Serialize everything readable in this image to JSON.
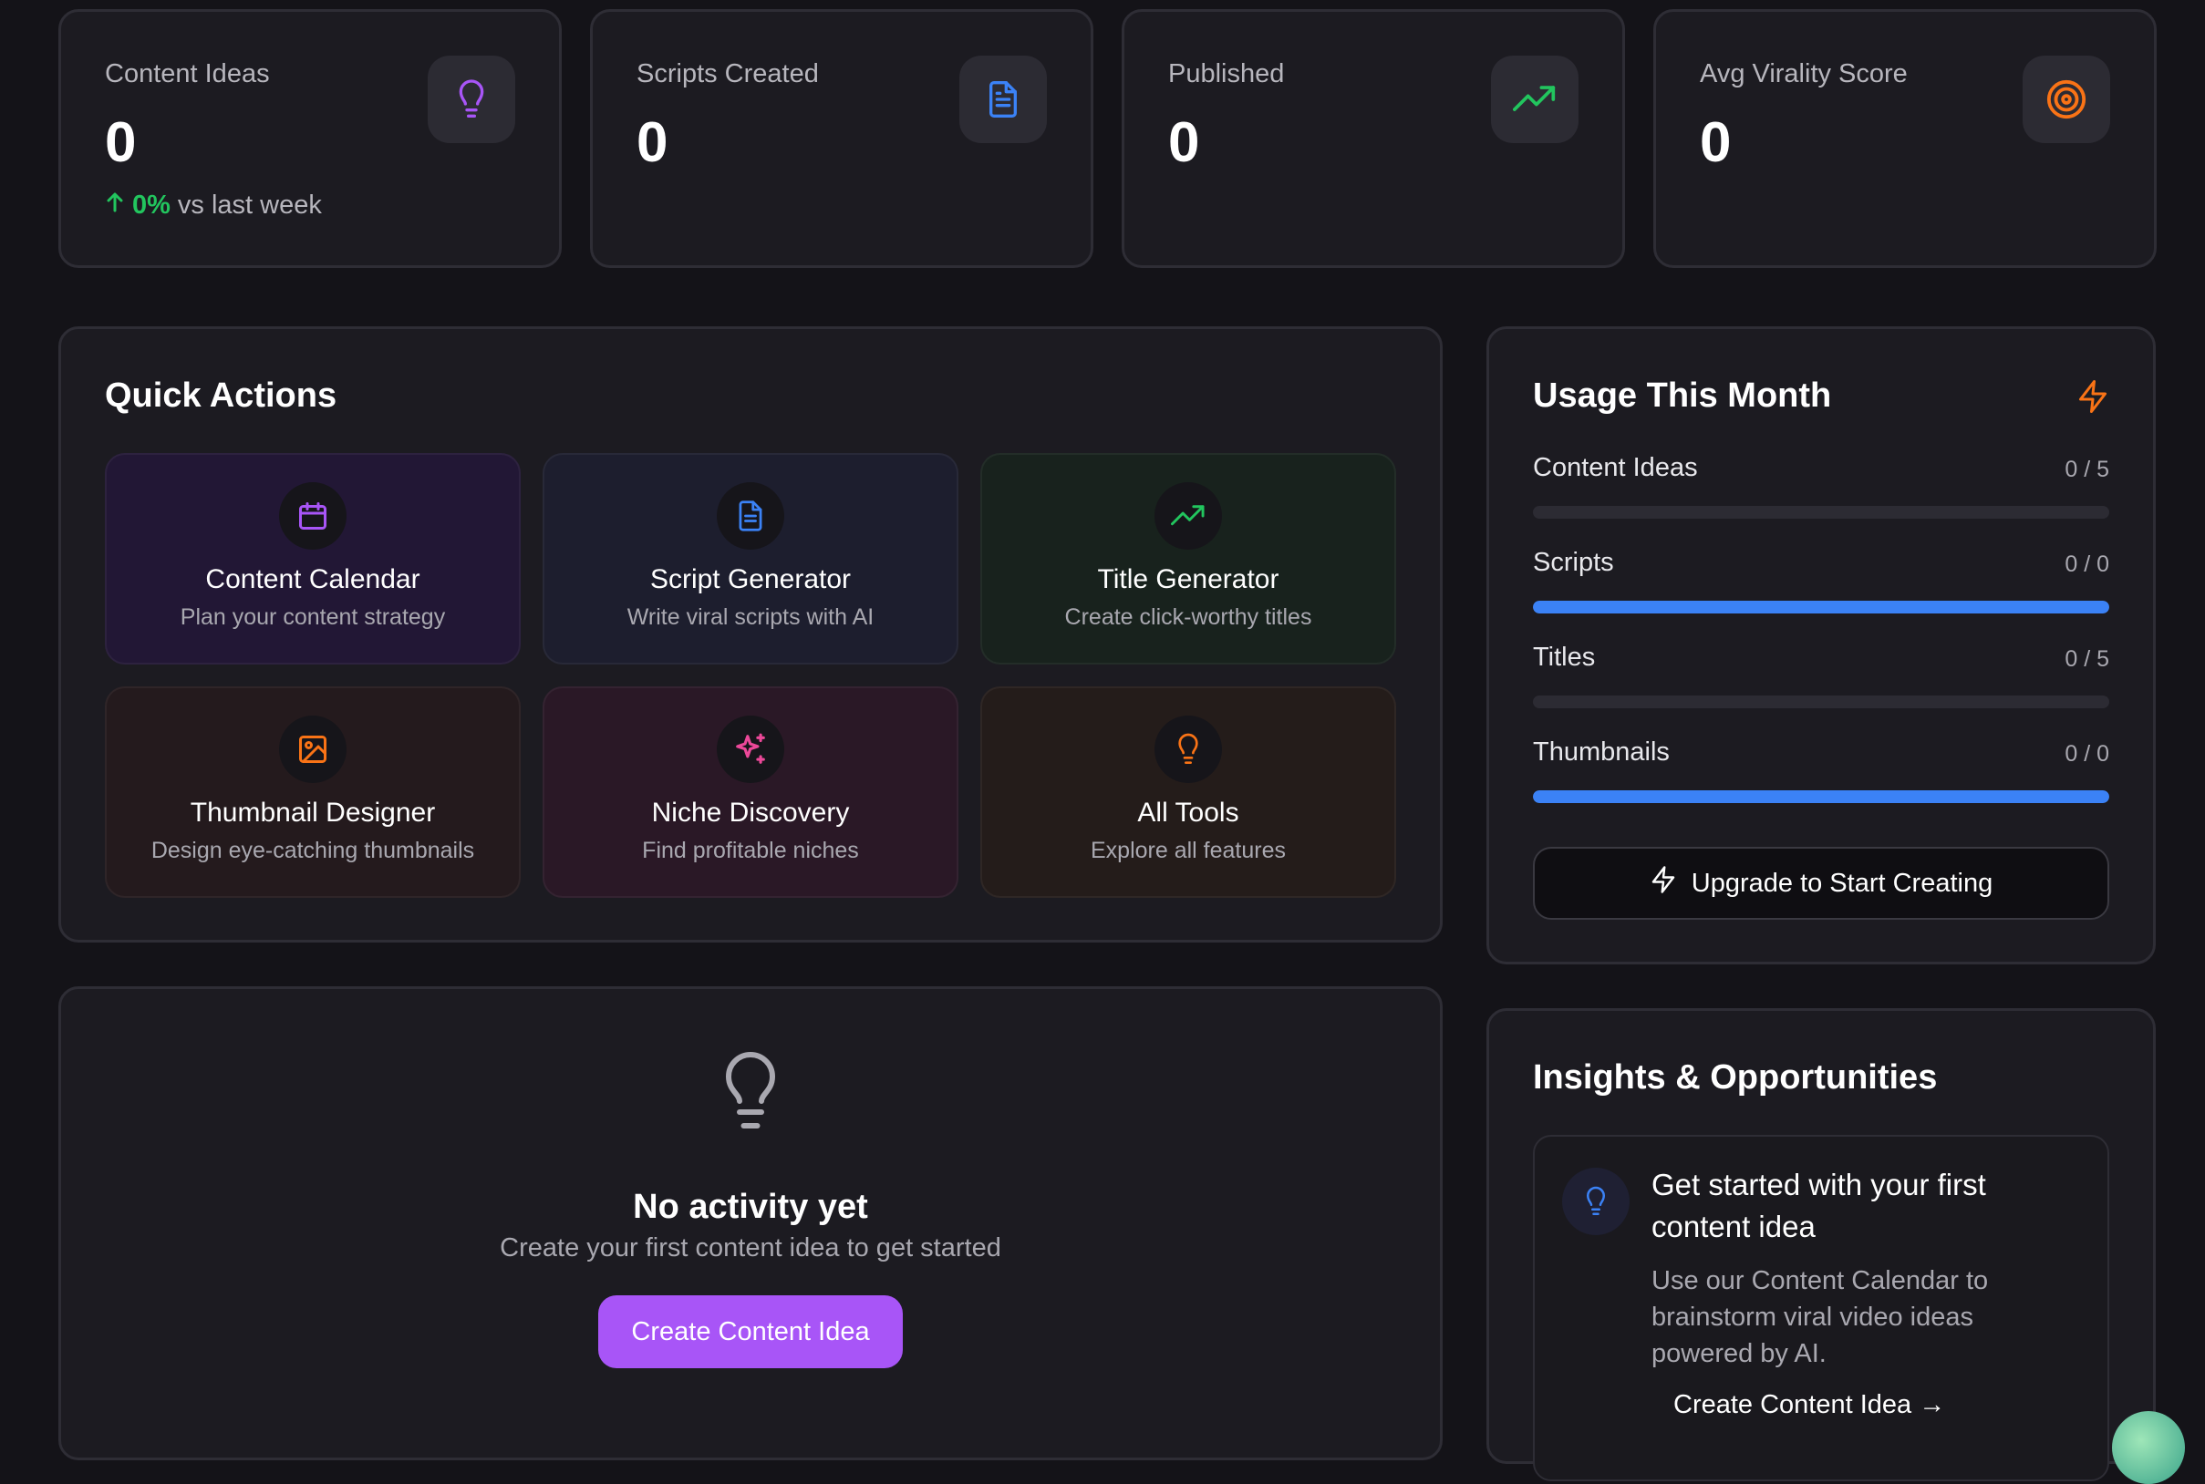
{
  "stats": [
    {
      "label": "Content Ideas",
      "value": "0",
      "icon": "lightbulb-icon",
      "trend_pct": "0%",
      "trend_text": "vs last week"
    },
    {
      "label": "Scripts Created",
      "value": "0",
      "icon": "document-icon"
    },
    {
      "label": "Published",
      "value": "0",
      "icon": "trending-up-icon"
    },
    {
      "label": "Avg Virality Score",
      "value": "0",
      "icon": "target-icon"
    }
  ],
  "quick_actions": {
    "title": "Quick Actions",
    "tiles": [
      {
        "name": "Content Calendar",
        "desc": "Plan your content strategy",
        "icon": "calendar-icon",
        "color": "#a855f7"
      },
      {
        "name": "Script Generator",
        "desc": "Write viral scripts with AI",
        "icon": "document-icon",
        "color": "#3b82f6"
      },
      {
        "name": "Title Generator",
        "desc": "Create click-worthy titles",
        "icon": "trending-up-icon",
        "color": "#22c55e"
      },
      {
        "name": "Thumbnail Designer",
        "desc": "Design eye-catching thumbnails",
        "icon": "image-icon",
        "color": "#f97316"
      },
      {
        "name": "Niche Discovery",
        "desc": "Find profitable niches",
        "icon": "sparkles-icon",
        "color": "#ec4899"
      },
      {
        "name": "All Tools",
        "desc": "Explore all features",
        "icon": "lightbulb-icon",
        "color": "#f97316"
      }
    ]
  },
  "usage": {
    "title": "Usage This Month",
    "rows": [
      {
        "label": "Content Ideas",
        "count": "0 / 5",
        "fill": 0
      },
      {
        "label": "Scripts",
        "count": "0 / 0",
        "fill": 1
      },
      {
        "label": "Titles",
        "count": "0 / 5",
        "fill": 0
      },
      {
        "label": "Thumbnails",
        "count": "0 / 0",
        "fill": 1
      }
    ],
    "upgrade_label": "Upgrade to Start Creating"
  },
  "activity": {
    "empty_title": "No activity yet",
    "empty_sub": "Create your first content idea to get started",
    "cta_label": "Create Content Idea"
  },
  "insights": {
    "title": "Insights & Opportunities",
    "card_title": "Get started with your first content idea",
    "card_desc": "Use our Content Calendar to brainstorm viral video ideas powered by AI.",
    "card_link": "Create Content Idea →"
  },
  "colors": {
    "accent": "#a855f7",
    "blue": "#3b82f6",
    "green": "#22c55e",
    "orange": "#f97316",
    "pink": "#ec4899"
  }
}
